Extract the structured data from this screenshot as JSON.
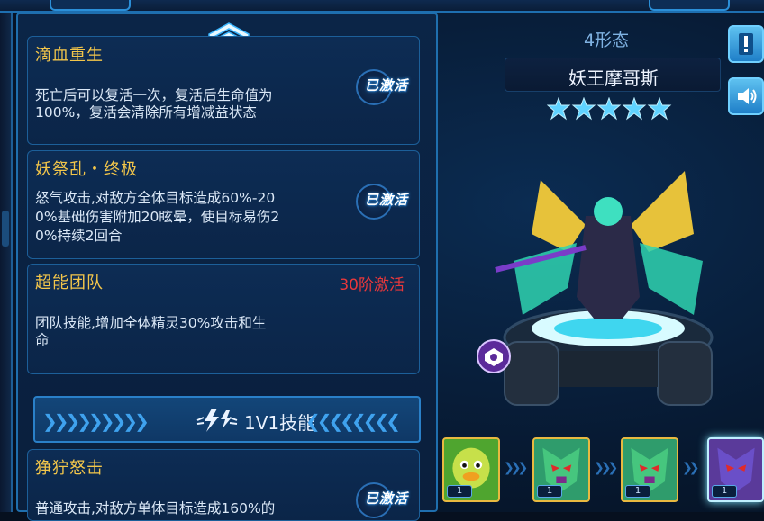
{
  "left": {
    "skills": [
      {
        "title": "滴血重生",
        "desc_lines": [
          "死亡后可以复活一次，复活后生命值为",
          "100%，复活会清除所有增减益状态"
        ],
        "badge": "已激活"
      },
      {
        "title": "妖祭乱・终极",
        "desc_lines": [
          "怒气攻击,对敌方全体目标造成60%-20",
          "0%基础伤害附加20眩晕，使目标易伤2",
          "0%持续2回合"
        ],
        "badge": "已激活"
      },
      {
        "title": "超能团队",
        "desc_lines": [
          "团队技能,增加全体精灵30%攻击和生",
          "命"
        ],
        "lock_text": "30阶激活"
      },
      {
        "title": "狰狞怒击",
        "desc_lines": [
          "普通攻击,对敌方单体目标造成160%的"
        ],
        "badge": "已激活"
      }
    ],
    "section_banner": {
      "label": "1V1技能"
    }
  },
  "right": {
    "form_label": "4形态",
    "name": "妖王摩哥斯",
    "stars": 5,
    "thumbs": [
      {
        "level": "1",
        "icon": "duck-pet-icon"
      },
      {
        "level": "1",
        "icon": "demon-pet-icon"
      },
      {
        "level": "1",
        "icon": "demon-pet-icon"
      },
      {
        "level": "1",
        "icon": "demon-pet-icon"
      }
    ]
  },
  "colors": {
    "gold": "#f3c64a",
    "red": "#e8383b",
    "accent": "#2a80c8",
    "text": "#dbe8f7"
  }
}
